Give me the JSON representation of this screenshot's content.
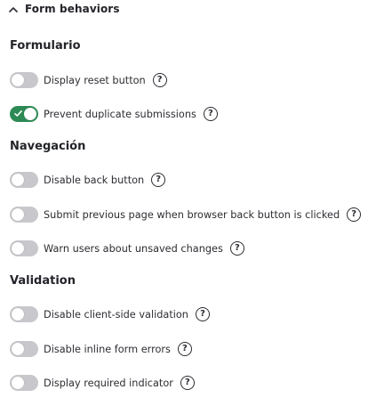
{
  "header": {
    "title": "Form behaviors",
    "chevron_icon": "chevron-up-icon",
    "expanded": true
  },
  "colors": {
    "toggle_on": "#2d8a55",
    "toggle_off": "#c8c8cc",
    "text": "#2c2d32"
  },
  "help_icon": "?",
  "sections": [
    {
      "title": "Formulario",
      "items": [
        {
          "label": "Display reset button",
          "enabled": false
        },
        {
          "label": "Prevent duplicate submissions",
          "enabled": true
        }
      ]
    },
    {
      "title": "Navegación",
      "items": [
        {
          "label": "Disable back button",
          "enabled": false
        },
        {
          "label": "Submit previous page when browser back button is clicked",
          "enabled": false
        },
        {
          "label": "Warn users about unsaved changes",
          "enabled": false
        }
      ]
    },
    {
      "title": "Validation",
      "items": [
        {
          "label": "Disable client-side validation",
          "enabled": false
        },
        {
          "label": "Disable inline form errors",
          "enabled": false
        },
        {
          "label": "Display required indicator",
          "enabled": false
        }
      ]
    }
  ]
}
